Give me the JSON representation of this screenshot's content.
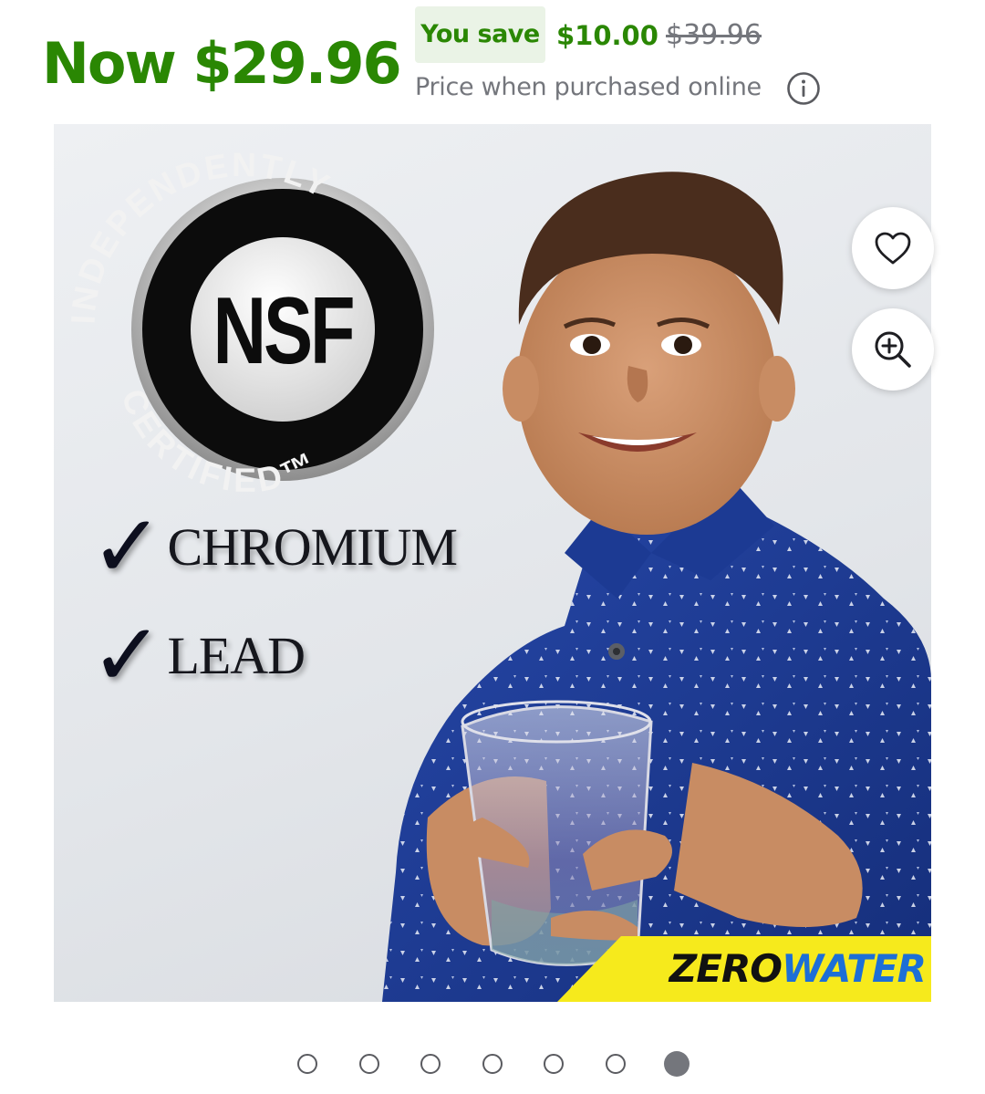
{
  "price": {
    "now_label": "Now $29.96",
    "save_badge": "You save",
    "save_amount": "$10.00",
    "was_price": "$39.96",
    "note": "Price when purchased online",
    "info_icon": "info-circle-icon"
  },
  "gallery": {
    "seal": {
      "top_text": "INDEPENDENTLY",
      "center_text": "NSF",
      "bottom_text": "CERTIFIED™"
    },
    "checklist": [
      "CHROMIUM",
      "LEAD"
    ],
    "brand": {
      "part1": "ZERO",
      "part2": "WATER"
    },
    "favorite_icon": "heart-icon",
    "zoom_icon": "zoom-in-icon"
  },
  "carousel": {
    "count": 7,
    "active_index": 6
  },
  "colors": {
    "price_green": "#2a8703",
    "muted_gray": "#74767c",
    "shirt_blue": "#1f3f9a",
    "brand_yellow": "#f6ea1c"
  }
}
